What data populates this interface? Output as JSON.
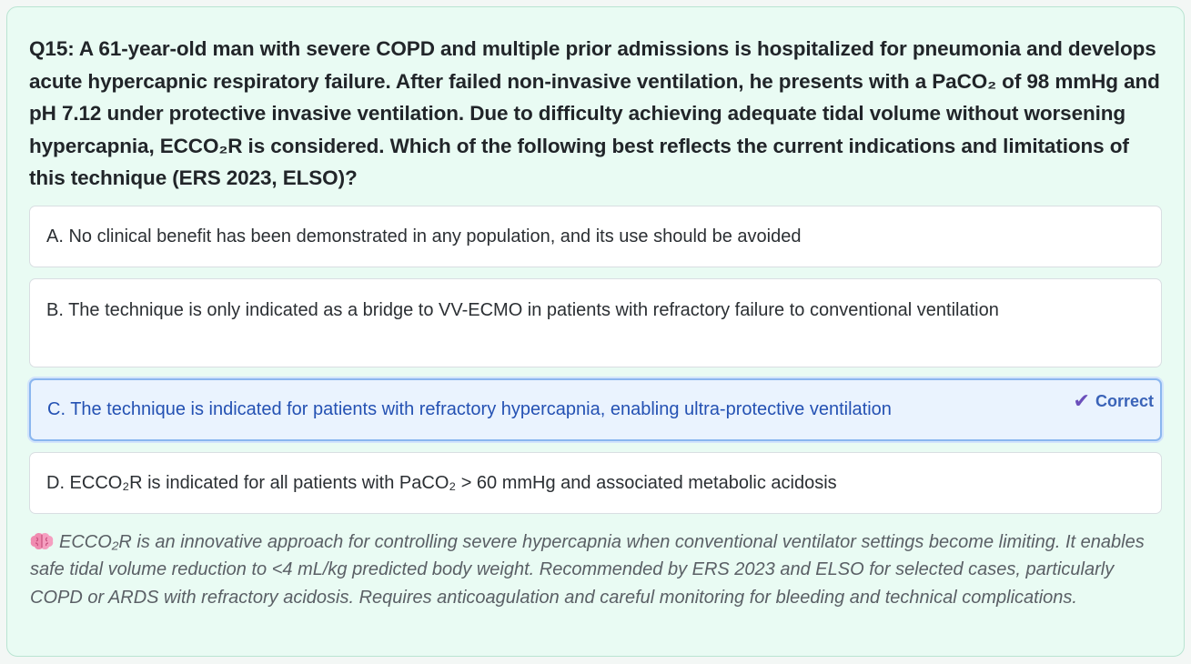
{
  "question": {
    "text": "Q15: A 61-year-old man with severe COPD and multiple prior admissions is hospitalized for pneumonia and develops acute hypercapnic respiratory failure. After failed non-invasive ventilation, he presents with a PaCO₂ of 98 mmHg and pH 7.12 under protective invasive ventilation. Due to difficulty achieving adequate tidal volume without worsening hypercapnia, ECCO₂R is considered. Which of the following best reflects the current indications and limitations of this technique (ERS 2023, ELSO)?"
  },
  "options": [
    {
      "text": "A. No clinical benefit has been demonstrated in any population, and its use should be avoided"
    },
    {
      "text": "B. The technique is only indicated as a bridge to VV-ECMO in patients with refractory failure to conventional ventilation"
    },
    {
      "text": "C. The technique is indicated for patients with refractory hypercapnia, enabling ultra-protective ventilation",
      "badge": "Correct"
    },
    {
      "text": "D. ECCO₂R is indicated for all patients with PaCO₂ > 60 mmHg and associated metabolic acidosis"
    }
  ],
  "explanation": {
    "icon": "brain-icon",
    "text": "ECCO₂R is an innovative approach for controlling severe hypercapnia when conventional ventilator settings become limiting. It enables safe tidal volume reduction to <4 mL/kg predicted body weight. Recommended by ERS 2023 and ELSO for selected cases, particularly COPD or ARDS with refractory acidosis. Requires anticoagulation and careful monitoring for bleeding and technical complications."
  },
  "colors": {
    "card_background": "#e9fbf3",
    "correct_background": "#eaf3fe",
    "correct_text": "#2451b3",
    "check_icon": "#6b4fbb"
  }
}
